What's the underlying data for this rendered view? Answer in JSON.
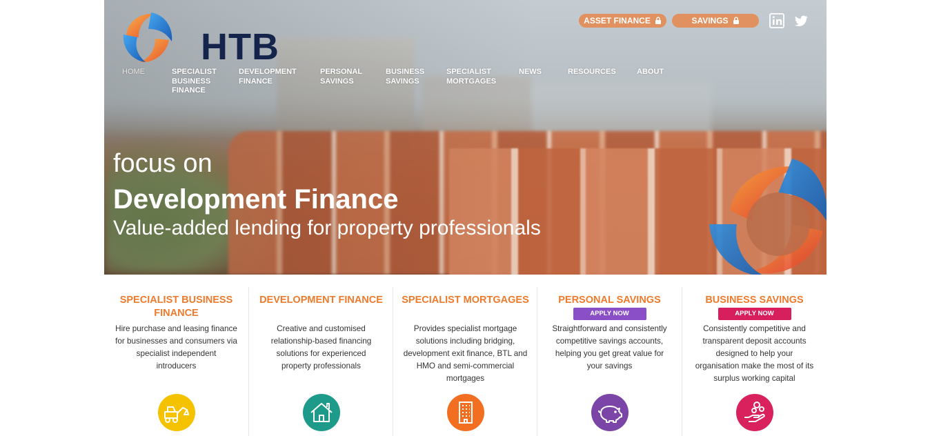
{
  "brand": {
    "logo_text": "HTB"
  },
  "top_links": {
    "asset_finance": "ASSET FINANCE",
    "savings": "SAVINGS",
    "linkedin_icon": "linkedin-icon",
    "twitter_icon": "twitter-icon"
  },
  "nav": {
    "home": "HOME",
    "specialist_business_finance": [
      "SPECIALIST",
      "BUSINESS",
      "FINANCE"
    ],
    "development_finance": [
      "DEVELOPMENT",
      "FINANCE"
    ],
    "personal_savings": [
      "PERSONAL",
      "SAVINGS"
    ],
    "business_savings": [
      "BUSINESS",
      "SAVINGS"
    ],
    "specialist_mortgages": [
      "SPECIALIST",
      "MORTGAGES"
    ],
    "news": "NEWS",
    "resources": "RESOURCES",
    "about": "ABOUT"
  },
  "hero": {
    "line1": "focus on",
    "line2": "Development Finance",
    "line3": "Value-added lending for property professionals"
  },
  "cards": [
    {
      "title": [
        "SPECIALIST BUSINESS",
        "FINANCE"
      ],
      "desc": [
        "Hire purchase and leasing finance",
        "for businesses and consumers via",
        "specialist independent",
        "introducers"
      ],
      "icon": "digger-icon",
      "color": "#f5c200"
    },
    {
      "title": [
        "DEVELOPMENT FINANCE"
      ],
      "desc": [
        "Creative and customised",
        "relationship-based financing",
        "solutions for experienced",
        "property professionals"
      ],
      "icon": "house-icon",
      "color": "#1e9a8a"
    },
    {
      "title": [
        "SPECIALIST MORTGAGES"
      ],
      "desc": [
        "Provides specialist mortgage",
        "solutions including bridging,",
        "development exit finance, BTL and",
        "HMO and semi-commercial",
        "mortgages"
      ],
      "icon": "building-icon",
      "color": "#f26f21"
    },
    {
      "title": [
        "PERSONAL SAVINGS"
      ],
      "apply": "APPLY NOW",
      "apply_color": "#8a4fc7",
      "desc": [
        "Straightforward and consistently",
        "competitive savings accounts,",
        "helping you get great value for",
        "your savings"
      ],
      "icon": "piggy-bank-icon",
      "color": "#7b45a8"
    },
    {
      "title": [
        "BUSINESS SAVINGS"
      ],
      "apply": "APPLY NOW",
      "apply_color": "#d61f5c",
      "desc": [
        "Consistently competitive and",
        "transparent deposit accounts",
        "designed to help your",
        "organisation make the most of its",
        "surplus working capital"
      ],
      "icon": "hand-coins-icon",
      "color": "#d9215e"
    }
  ],
  "colors": {
    "accent_orange": "#ee7a2c",
    "brand_navy": "#14244a",
    "top_button": "#e0915f"
  }
}
